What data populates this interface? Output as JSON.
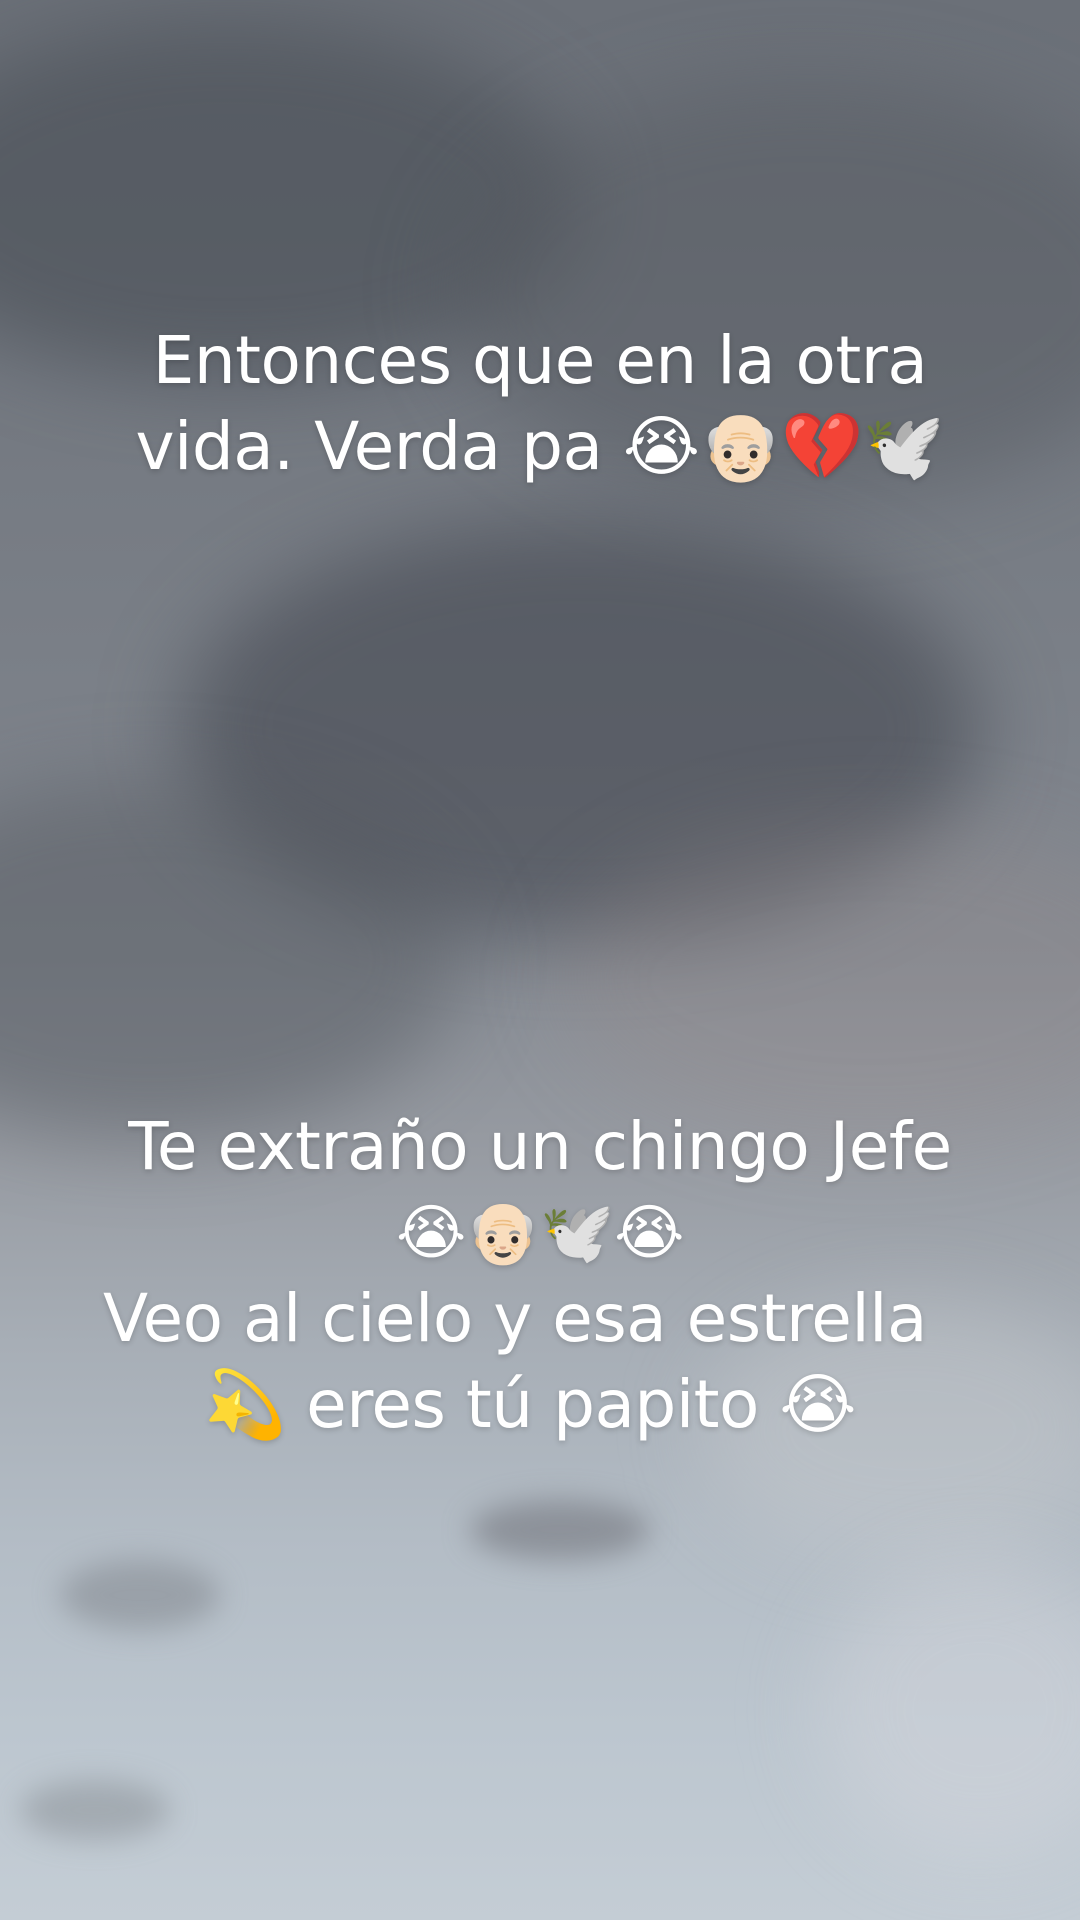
{
  "captions": {
    "top": {
      "line1": "Entonces que en la otra",
      "line2": "vida. Verda pa 😭👴🏻💔🕊️"
    },
    "bottom": {
      "line1": "Te extraño un chingo Jefe",
      "line2": "😭👴🏻🕊️😭",
      "line3": "Veo al cielo y esa estrella",
      "line4": "💫 eres tú papito 😭"
    }
  }
}
